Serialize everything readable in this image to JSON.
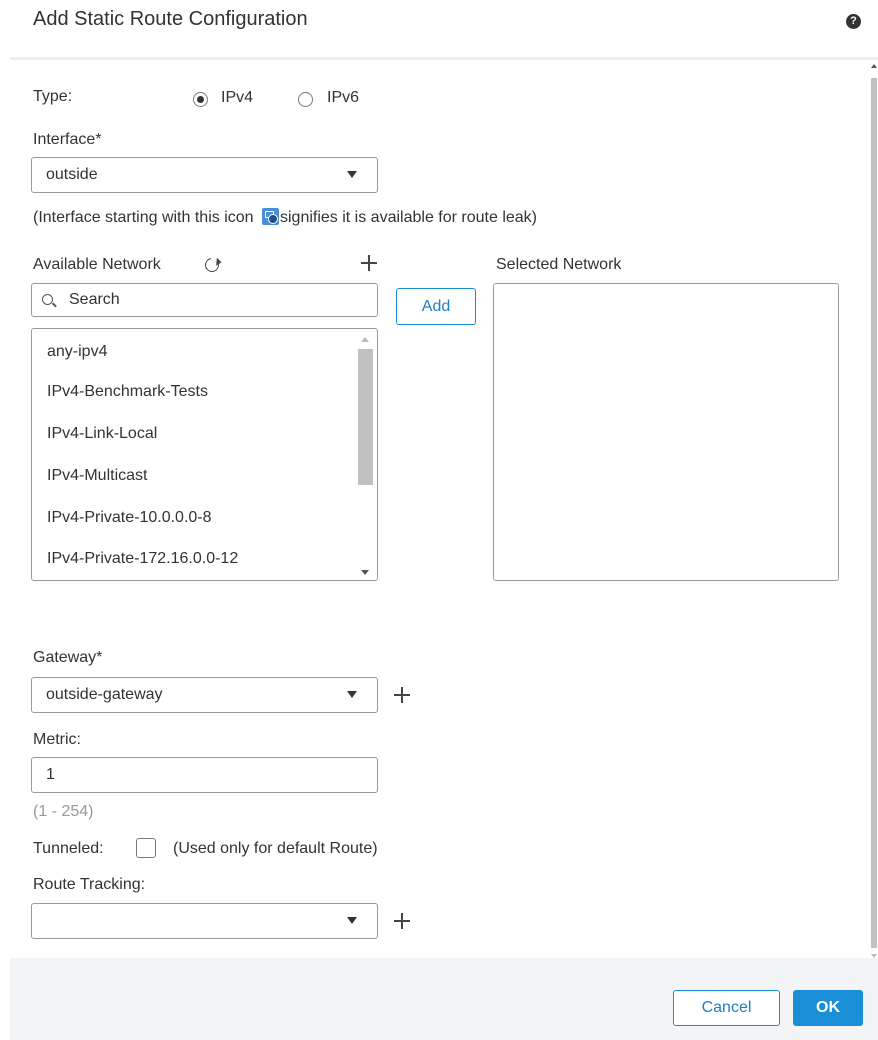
{
  "dialog": {
    "title": "Add Static Route Configuration",
    "help_icon": "question-circle-icon"
  },
  "type": {
    "label": "Type:",
    "options": [
      {
        "label": "IPv4",
        "selected": true
      },
      {
        "label": "IPv6",
        "selected": false
      }
    ]
  },
  "interface": {
    "label": "Interface*",
    "value": "outside",
    "hint_before": "(Interface starting with this icon ",
    "hint_after": "signifies it is available for route leak)",
    "hint_icon": "route-leak-icon"
  },
  "available_network": {
    "label": "Available Network",
    "search_placeholder": "Search",
    "items": [
      "any-ipv4",
      "IPv4-Benchmark-Tests",
      "IPv4-Link-Local",
      "IPv4-Multicast",
      "IPv4-Private-10.0.0.0-8",
      "IPv4-Private-172.16.0.0-12"
    ]
  },
  "add_button": "Add",
  "selected_network": {
    "label": "Selected Network"
  },
  "gateway": {
    "label": "Gateway*",
    "value": "outside-gateway"
  },
  "metric": {
    "label": "Metric:",
    "value": "1",
    "range_hint": "(1 - 254)"
  },
  "tunneled": {
    "label": "Tunneled:",
    "checked": false,
    "note": "(Used only for default Route)"
  },
  "route_tracking": {
    "label": "Route Tracking:",
    "value": ""
  },
  "footer": {
    "cancel_label": "Cancel",
    "ok_label": "OK"
  },
  "colors": {
    "accent": "#1a8fd8",
    "footer_bg": "#f3f4f5"
  }
}
